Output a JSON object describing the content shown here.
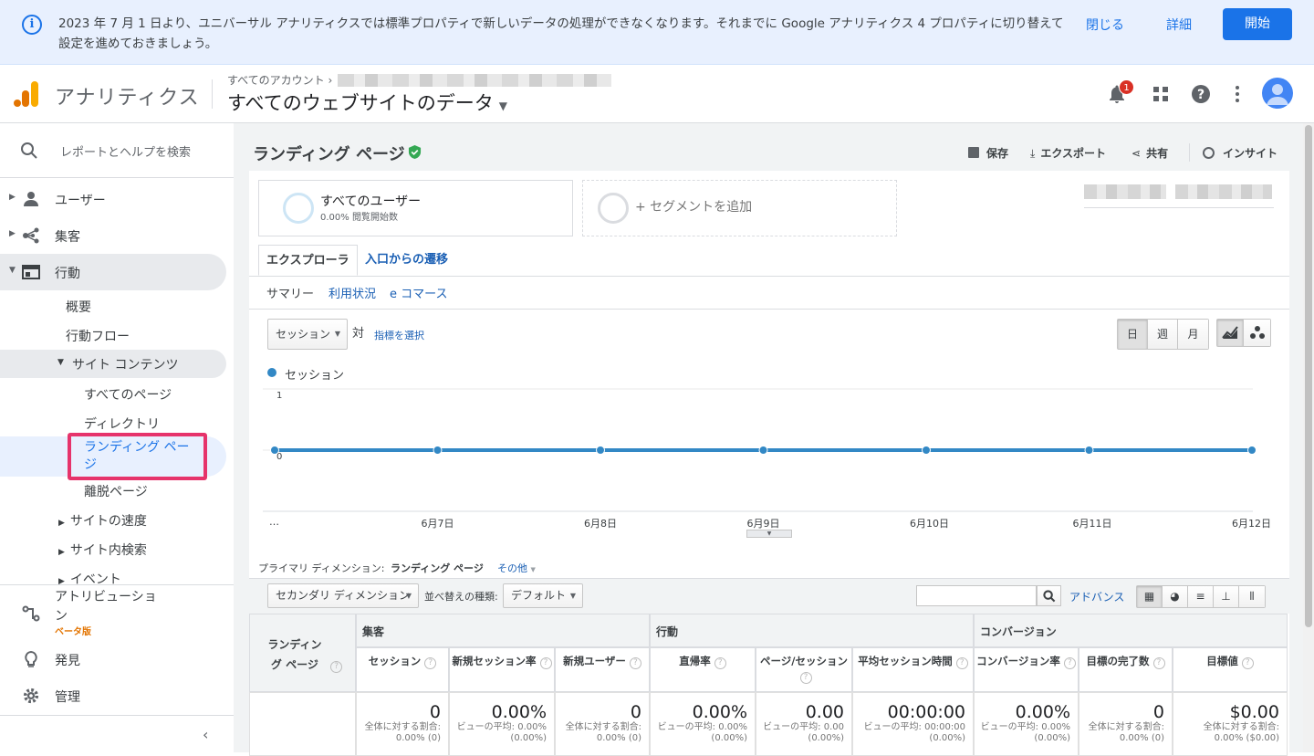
{
  "banner": {
    "message": "2023 年 7 月 1 日より、ユニバーサル アナリティクスでは標準プロパティで新しいデータの処理ができなくなります。それまでに Google アナリティクス 4 プロパティに切り替えて設定を進めておきましょう。",
    "close_label": "閉じる",
    "details_label": "詳細",
    "start_label": "開始"
  },
  "header": {
    "app_name": "アナリティクス",
    "breadcrumb": "すべてのアカウント ›",
    "property": "すべてのウェブサイトのデータ",
    "notification_count": "1"
  },
  "sidebar": {
    "search_placeholder": "レポートとヘルプを検索",
    "items": [
      {
        "label": "ユーザー"
      },
      {
        "label": "集客"
      },
      {
        "label": "行動"
      }
    ],
    "behavior_sub": [
      "概要",
      "行動フロー"
    ],
    "site_contents": "サイト コンテンツ",
    "site_contents_sub": [
      "すべてのページ",
      "ディレクトリ",
      "ランディング ページ",
      "離脱ページ"
    ],
    "collapsed": [
      "サイトの速度",
      "サイト内検索",
      "イベント"
    ],
    "attribution": "アトリビューション",
    "beta": "ベータ版",
    "discover": "発見",
    "admin": "管理"
  },
  "report": {
    "title": "ランディング ページ",
    "actions": [
      "保存",
      "エクスポート",
      "共有",
      "インサイト"
    ],
    "segment_name": "すべてのユーザー",
    "segment_sub": "0.00% 閲覧開始数",
    "add_segment": "+ セグメントを追加",
    "tabs": [
      "エクスプローラ",
      "入口からの遷移"
    ],
    "subtabs": [
      "サマリー",
      "利用状況",
      "e コマース"
    ],
    "metric_select": "セッション",
    "vs_label": "対",
    "choose_metric": "指標を選択",
    "period_buttons": [
      "日",
      "週",
      "月"
    ]
  },
  "chart_data": {
    "type": "line",
    "series": [
      {
        "name": "セッション",
        "values": [
          0,
          0,
          0,
          0,
          0,
          0,
          0
        ]
      }
    ],
    "categories": [
      "…",
      "6月7日",
      "6月8日",
      "6月9日",
      "6月10日",
      "6月11日",
      "6月12日"
    ],
    "ylim": [
      0,
      1
    ],
    "yticks": [
      "1",
      "0"
    ],
    "colors": {
      "line": "#3288c5"
    }
  },
  "dimension": {
    "label": "プライマリ ディメンション:",
    "value": "ランディング ページ",
    "other": "その他",
    "secondary": "セカンダリ ディメンション",
    "sort_label": "並べ替えの種類:",
    "sort_value": "デフォルト",
    "advanced": "アドバンス"
  },
  "table": {
    "first_col": "ランディング ページ",
    "groups": [
      "集客",
      "行動",
      "コンバージョン"
    ],
    "columns": [
      {
        "label": "セッション",
        "value": "0",
        "sub": "全体に対する割合: 0.00% (0)"
      },
      {
        "label": "新規セッション率",
        "value": "0.00%",
        "sub": "ビューの平均: 0.00% (0.00%)"
      },
      {
        "label": "新規ユーザー",
        "value": "0",
        "sub": "全体に対する割合: 0.00% (0)"
      },
      {
        "label": "直帰率",
        "value": "0.00%",
        "sub": "ビューの平均: 0.00% (0.00%)"
      },
      {
        "label": "ページ/セッション",
        "value": "0.00",
        "sub": "ビューの平均: 0.00 (0.00%)"
      },
      {
        "label": "平均セッション時間",
        "value": "00:00:00",
        "sub": "ビューの平均: 00:00:00 (0.00%)"
      },
      {
        "label": "コンバージョン率",
        "value": "0.00%",
        "sub": "ビューの平均: 0.00% (0.00%)"
      },
      {
        "label": "目標の完了数",
        "value": "0",
        "sub": "全体に対する割合: 0.00% (0)"
      },
      {
        "label": "目標値",
        "value": "$0.00",
        "sub": "全体に対する割合: 0.00% ($0.00)"
      }
    ]
  }
}
